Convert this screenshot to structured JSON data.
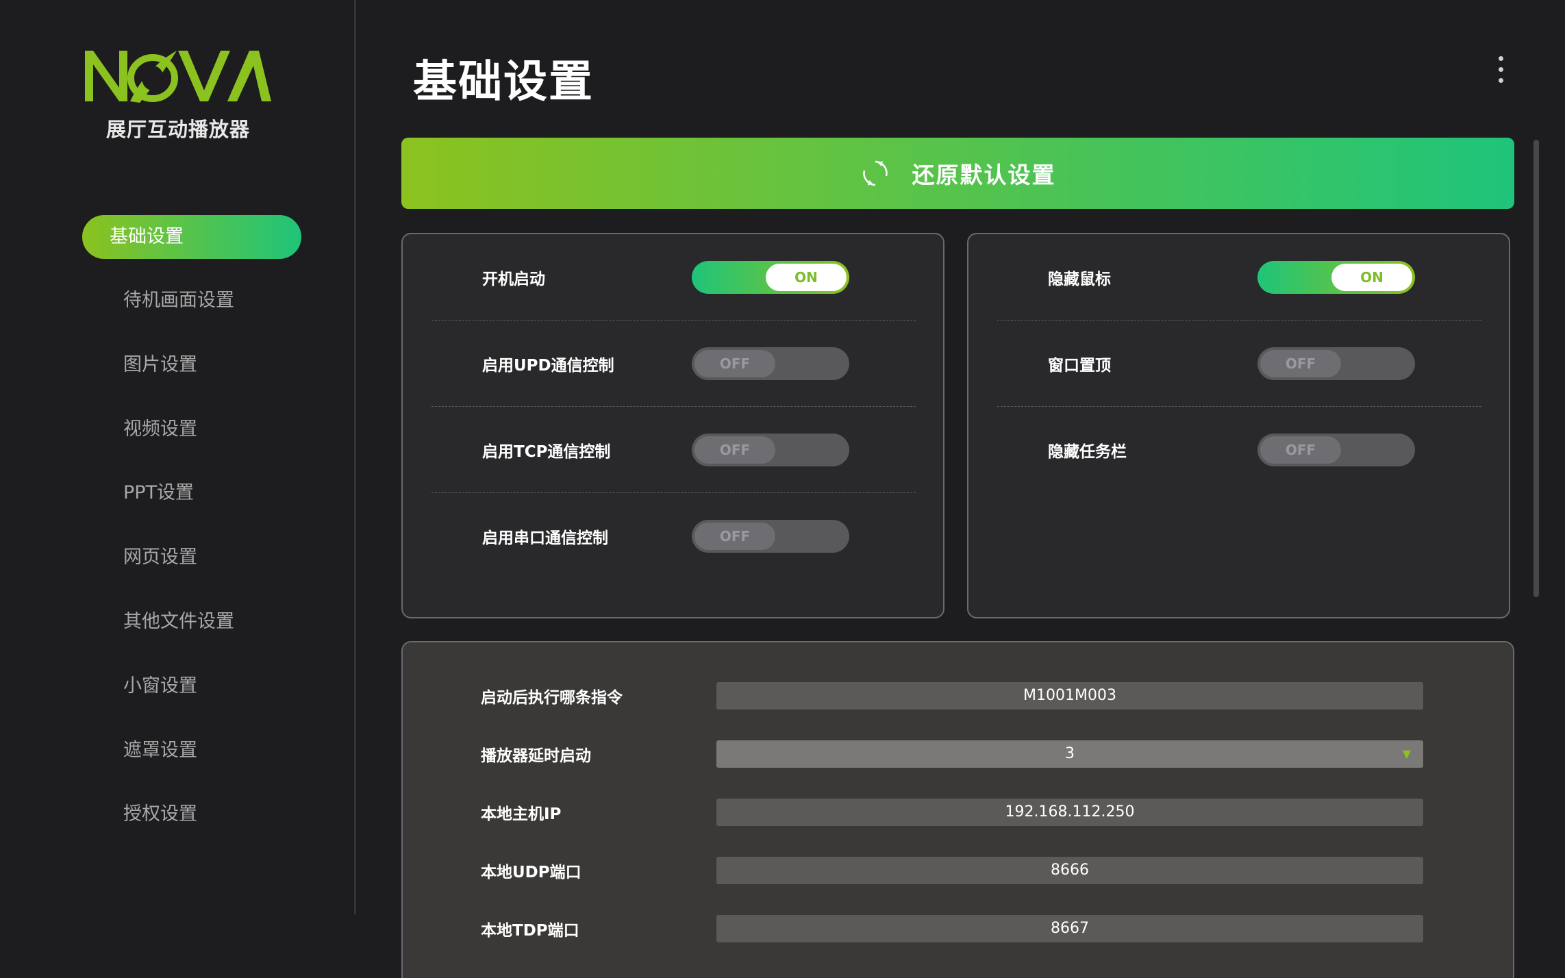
{
  "app": {
    "logo_text": "NOVA",
    "name": "展厅互动播放器",
    "accent_start": "#8cc21f",
    "accent_end": "#1fc47a"
  },
  "sidebar": {
    "items": [
      {
        "label": "基础设置",
        "active": true
      },
      {
        "label": "待机画面设置",
        "active": false
      },
      {
        "label": "图片设置",
        "active": false
      },
      {
        "label": "视频设置",
        "active": false
      },
      {
        "label": "PPT设置",
        "active": false
      },
      {
        "label": "网页设置",
        "active": false
      },
      {
        "label": "其他文件设置",
        "active": false
      },
      {
        "label": "小窗设置",
        "active": false
      },
      {
        "label": "遮罩设置",
        "active": false
      },
      {
        "label": "授权设置",
        "active": false
      }
    ]
  },
  "header": {
    "title": "基础设置",
    "more_icon": "more-vertical-icon"
  },
  "reset": {
    "label": "还原默认设置",
    "icon": "refresh-icon"
  },
  "toggles_left": [
    {
      "label": "开机启动",
      "state": "ON"
    },
    {
      "label": "启用UPD通信控制",
      "state": "OFF"
    },
    {
      "label": "启用TCP通信控制",
      "state": "OFF"
    },
    {
      "label": "启用串口通信控制",
      "state": "OFF"
    }
  ],
  "toggles_right": [
    {
      "label": "隐藏鼠标",
      "state": "ON"
    },
    {
      "label": "窗口置顶",
      "state": "OFF"
    },
    {
      "label": "隐藏任务栏",
      "state": "OFF"
    }
  ],
  "fields": [
    {
      "label": "启动后执行哪条指令",
      "value": "M1001M003",
      "type": "text"
    },
    {
      "label": "播放器延时启动",
      "value": "3",
      "type": "select"
    },
    {
      "label": "本地主机IP",
      "value": "192.168.112.250",
      "type": "text"
    },
    {
      "label": "本地UDP端口",
      "value": "8666",
      "type": "text"
    },
    {
      "label": "本地TDP端口",
      "value": "8667",
      "type": "text"
    }
  ]
}
